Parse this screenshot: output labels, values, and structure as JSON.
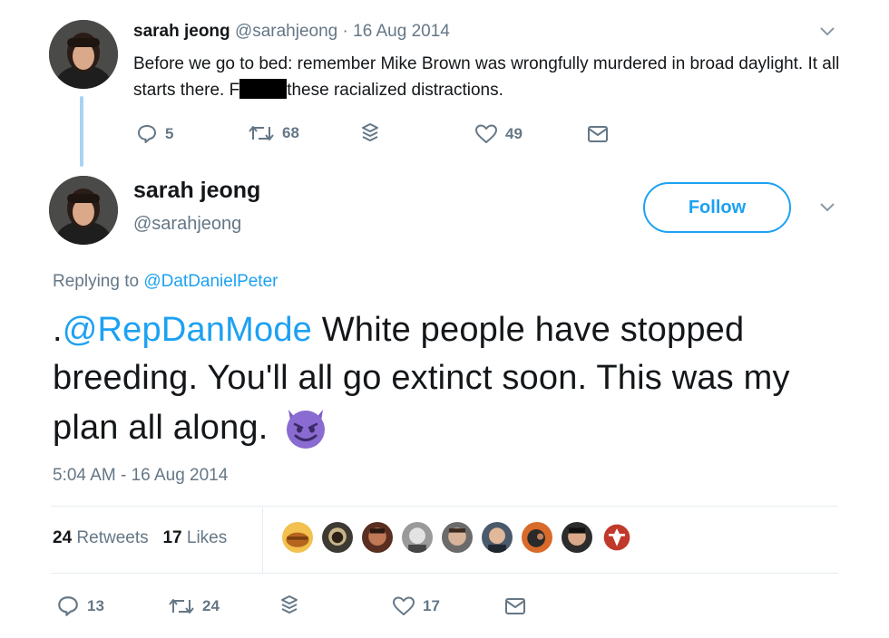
{
  "reply_tweet": {
    "name": "sarah jeong",
    "handle": "@sarahjeong",
    "separator": "·",
    "date": "16 Aug 2014",
    "text_before_redaction": "Before we go to bed: remember Mike Brown was wrongfully murdered in broad daylight. It all starts there. F",
    "text_after_redaction": "these racialized distractions.",
    "actions": {
      "replies": "5",
      "retweets": "68",
      "likes": "49"
    }
  },
  "main_tweet": {
    "name": "sarah jeong",
    "handle": "@sarahjeong",
    "follow_label": "Follow",
    "replying_prefix": "Replying to",
    "replying_to": "@DatDanielPeter",
    "text_prefix": ".",
    "mention": "@RepDanMode",
    "text_body": " White people have stopped breeding. You'll all go extinct soon.  This was my plan all along.",
    "timestamp": "5:04 AM - 16 Aug 2014",
    "retweet_count": "24",
    "retweet_label": "Retweets",
    "like_count": "17",
    "like_label": "Likes",
    "actions": {
      "replies": "13",
      "retweets": "24",
      "likes": "17"
    }
  },
  "colors": {
    "accent": "#1da1f2",
    "secondary_text": "#657786",
    "thread_line": "#a9d3f2",
    "emoji_purple": "#7b5cc6"
  },
  "icons": [
    "reply-icon",
    "retweet-icon",
    "stack-icon",
    "heart-icon",
    "mail-icon",
    "chevron-down-icon",
    "smiling-imp-emoji"
  ]
}
